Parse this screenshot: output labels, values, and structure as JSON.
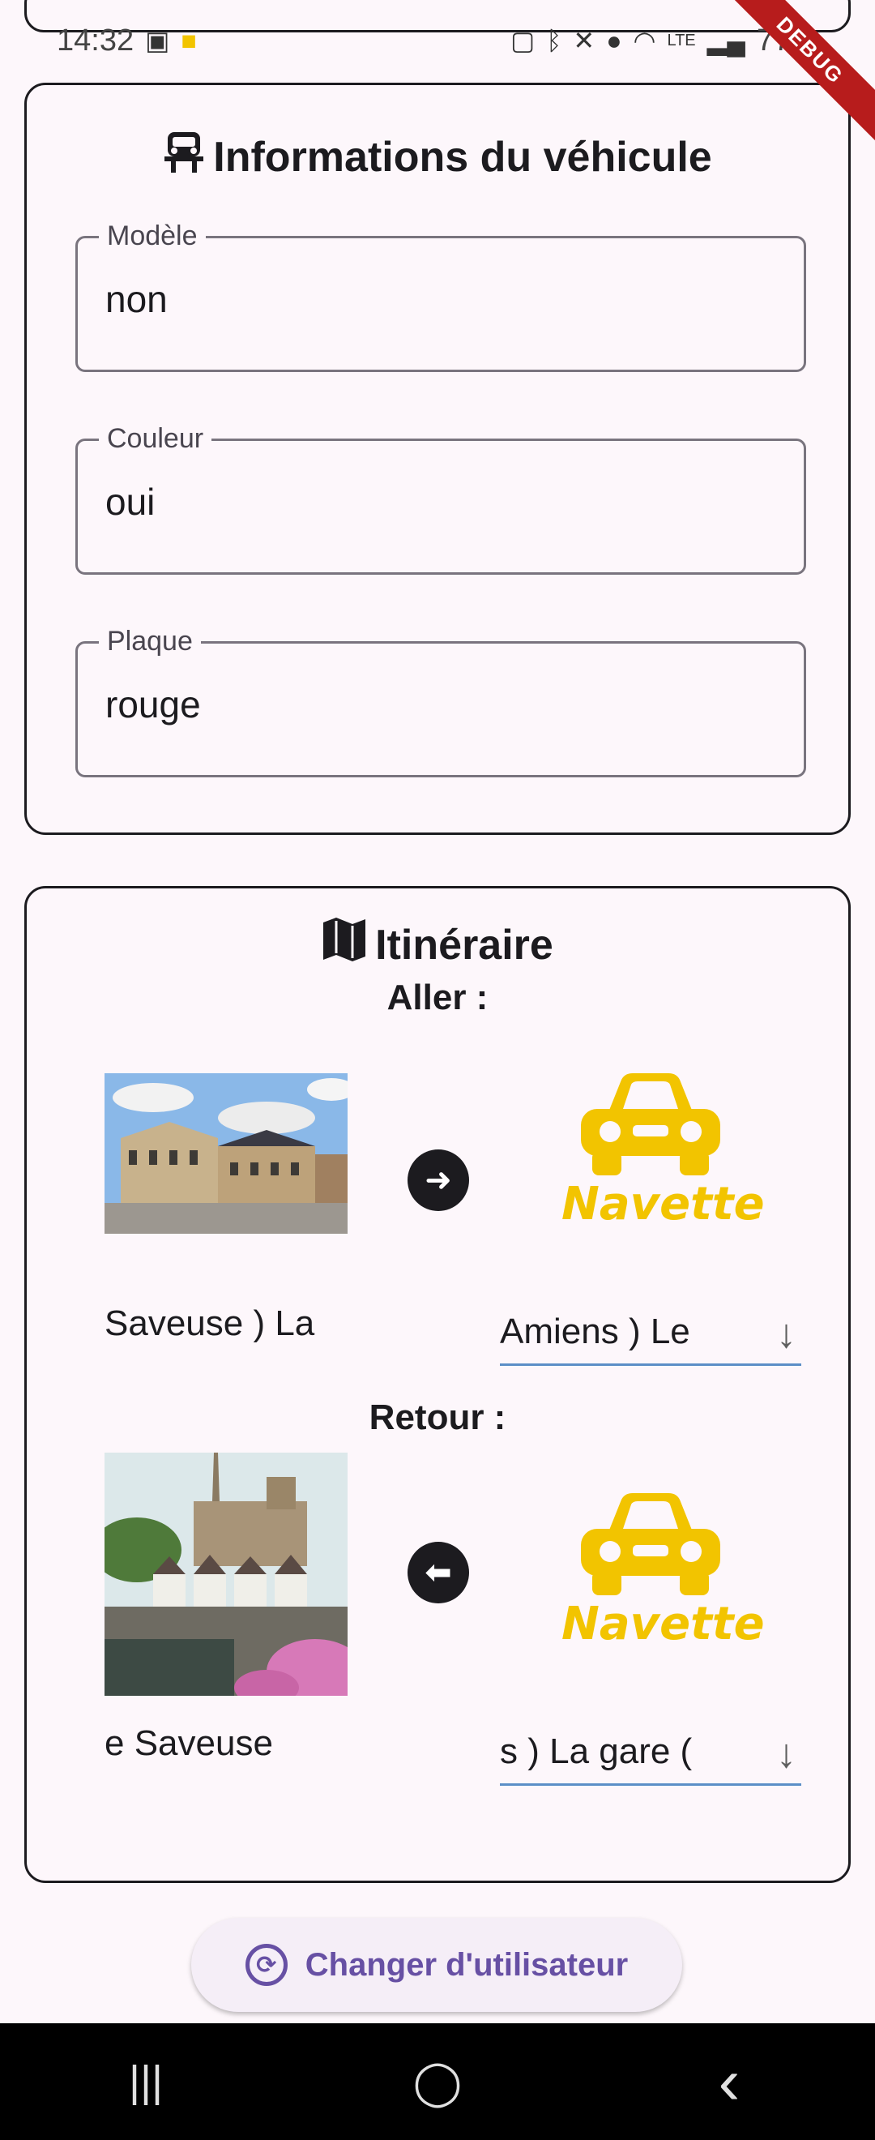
{
  "status_bar": {
    "time": "14:32",
    "battery": "77%",
    "left_icons": [
      "image-icon",
      "taxi-app-icon"
    ],
    "right_icons": [
      "nfc-icon",
      "bluetooth-icon",
      "mute-icon",
      "location-icon",
      "wifi-icon",
      "volte-icon",
      "signal-icon"
    ]
  },
  "debug_banner": "DEBUG",
  "vehicle": {
    "title": "Informations du véhicule",
    "title_icon": "car-icon",
    "fields": [
      {
        "label": "Modèle",
        "value": "non"
      },
      {
        "label": "Couleur",
        "value": "oui"
      },
      {
        "label": "Plaque",
        "value": "rouge"
      }
    ]
  },
  "itinerary": {
    "title": "Itinéraire",
    "title_icon": "map-icon",
    "aller": {
      "label": "Aller :",
      "origin_photo": "palace-square-photo",
      "arrow_icon": "arrow-right-icon",
      "destination_name": "Navette",
      "origin_text": "Saveuse )    La",
      "destination_dropdown": "Amiens )    Le"
    },
    "retour": {
      "label": "Retour :",
      "origin_photo": "cathedral-river-photo",
      "arrow_icon": "arrow-left-icon",
      "destination_name": "Navette",
      "origin_text": "e       Saveuse",
      "destination_dropdown": "s )    La gare ("
    }
  },
  "switch_user": {
    "label": "Changer d'utilisateur",
    "icon": "sync-user-icon"
  },
  "nav_bar": {
    "recents": "|||",
    "home": "◯",
    "back": "‹"
  },
  "colors": {
    "background": "#fdf7fb",
    "navette_yellow": "#f2c400",
    "primary_purple": "#6750a4",
    "dropdown_underline": "#5b8fc7"
  }
}
